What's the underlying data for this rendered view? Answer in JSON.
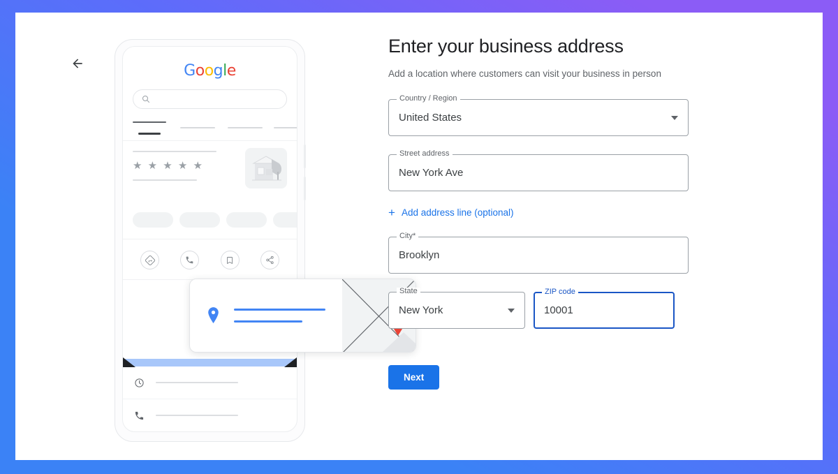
{
  "frame": {
    "gradient_start": "#3b82f6",
    "gradient_end": "#8b5cf6"
  },
  "nav": {
    "back_label": "Back",
    "back_icon": "arrow-left-icon"
  },
  "illustration": {
    "brand": {
      "letters": [
        {
          "char": "G",
          "color": "#4285F4"
        },
        {
          "char": "o",
          "color": "#EA4335"
        },
        {
          "char": "o",
          "color": "#FBBC05"
        },
        {
          "char": "g",
          "color": "#4285F4"
        },
        {
          "char": "l",
          "color": "#34A853"
        },
        {
          "char": "e",
          "color": "#EA4335"
        }
      ]
    },
    "search_icon": "search-icon",
    "rating_stars": "★ ★ ★ ★ ★",
    "star_count": 5,
    "action_icons": [
      "directions-icon",
      "phone-icon",
      "bookmark-icon",
      "share-icon"
    ],
    "detail_icons": [
      "clock-icon",
      "phone-icon",
      "globe-icon"
    ],
    "address_card": {
      "pin_icon": "map-pin-icon",
      "pin_color": "#4285F4",
      "map_pin_icon": "map-marker-icon",
      "map_pin_color": "#EA4335"
    },
    "highlight_color": "#a8c7fa"
  },
  "form": {
    "title": "Enter your business address",
    "subtitle": "Add a location where customers can visit your business in person",
    "fields": [
      {
        "name": "country-region",
        "label": "Country / Region",
        "value": "United States",
        "type": "select",
        "focused": false
      },
      {
        "name": "street-address",
        "label": "Street address",
        "value": "New York Ave",
        "type": "text",
        "focused": false
      },
      {
        "name": "city",
        "label": "City*",
        "value": "Brooklyn",
        "type": "text",
        "focused": false
      },
      {
        "name": "state",
        "label": "State",
        "value": "New York",
        "type": "select",
        "focused": false
      },
      {
        "name": "zip-code",
        "label": "ZIP code",
        "value": "10001",
        "type": "text",
        "focused": true
      }
    ],
    "add_address_line": {
      "label": "Add address line (optional)",
      "icon": "plus-icon"
    },
    "next_label": "Next",
    "accent_color": "#1a73e8",
    "focus_color": "#1a56c5"
  }
}
